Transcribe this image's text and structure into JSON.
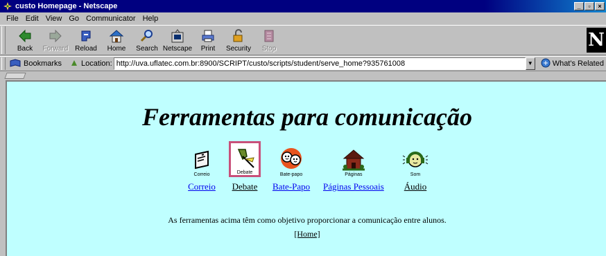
{
  "window": {
    "title": "custo Homepage - Netscape",
    "controls": [
      "_",
      "▫",
      "×"
    ]
  },
  "menu": [
    "File",
    "Edit",
    "View",
    "Go",
    "Communicator",
    "Help"
  ],
  "toolbar": [
    {
      "label": "Back",
      "icon": "back-arrow-icon",
      "enabled": true
    },
    {
      "label": "Forward",
      "icon": "forward-arrow-icon",
      "enabled": false
    },
    {
      "label": "Reload",
      "icon": "reload-icon",
      "enabled": true
    },
    {
      "label": "Home",
      "icon": "home-icon",
      "enabled": true
    },
    {
      "label": "Search",
      "icon": "search-icon",
      "enabled": true
    },
    {
      "label": "Netscape",
      "icon": "netscape-icon",
      "enabled": true
    },
    {
      "label": "Print",
      "icon": "print-icon",
      "enabled": true
    },
    {
      "label": "Security",
      "icon": "security-icon",
      "enabled": true
    },
    {
      "label": "Stop",
      "icon": "stop-icon",
      "enabled": false
    }
  ],
  "locationbar": {
    "bookmarks_label": "Bookmarks",
    "location_label": "Location:",
    "url": "http://uva.uflatec.com.br:8900/SCRIPT/custo/scripts/student/serve_home?935761008",
    "related_label": "What's Related"
  },
  "page": {
    "heading": "Ferramentas para comunicação",
    "tools": [
      {
        "caption": "Correio",
        "link": "Correio",
        "icon": "mail-icon",
        "selected": false,
        "visited": false
      },
      {
        "caption": "Debate",
        "link": "Debate",
        "icon": "pushpin-icon",
        "selected": true,
        "visited": true
      },
      {
        "caption": "Bate-papo",
        "link": "Bate-Papo",
        "icon": "chat-faces-icon",
        "selected": false,
        "visited": false
      },
      {
        "caption": "Páginas",
        "link": "Páginas Pessoais",
        "icon": "house-icon",
        "selected": false,
        "visited": false
      },
      {
        "caption": "Som",
        "link": "Áudio",
        "icon": "headphones-face-icon",
        "selected": false,
        "visited": true
      }
    ],
    "description": "As ferramentas acima têm como objetivo proporcionar a comunicação entre alunos.",
    "home_link": "[Home]"
  },
  "colors": {
    "titlebar": "#000080",
    "chrome": "#c0c0c0",
    "page_background": "#bfffff",
    "link": "#0000ee",
    "selected_border": "#c8507a"
  }
}
